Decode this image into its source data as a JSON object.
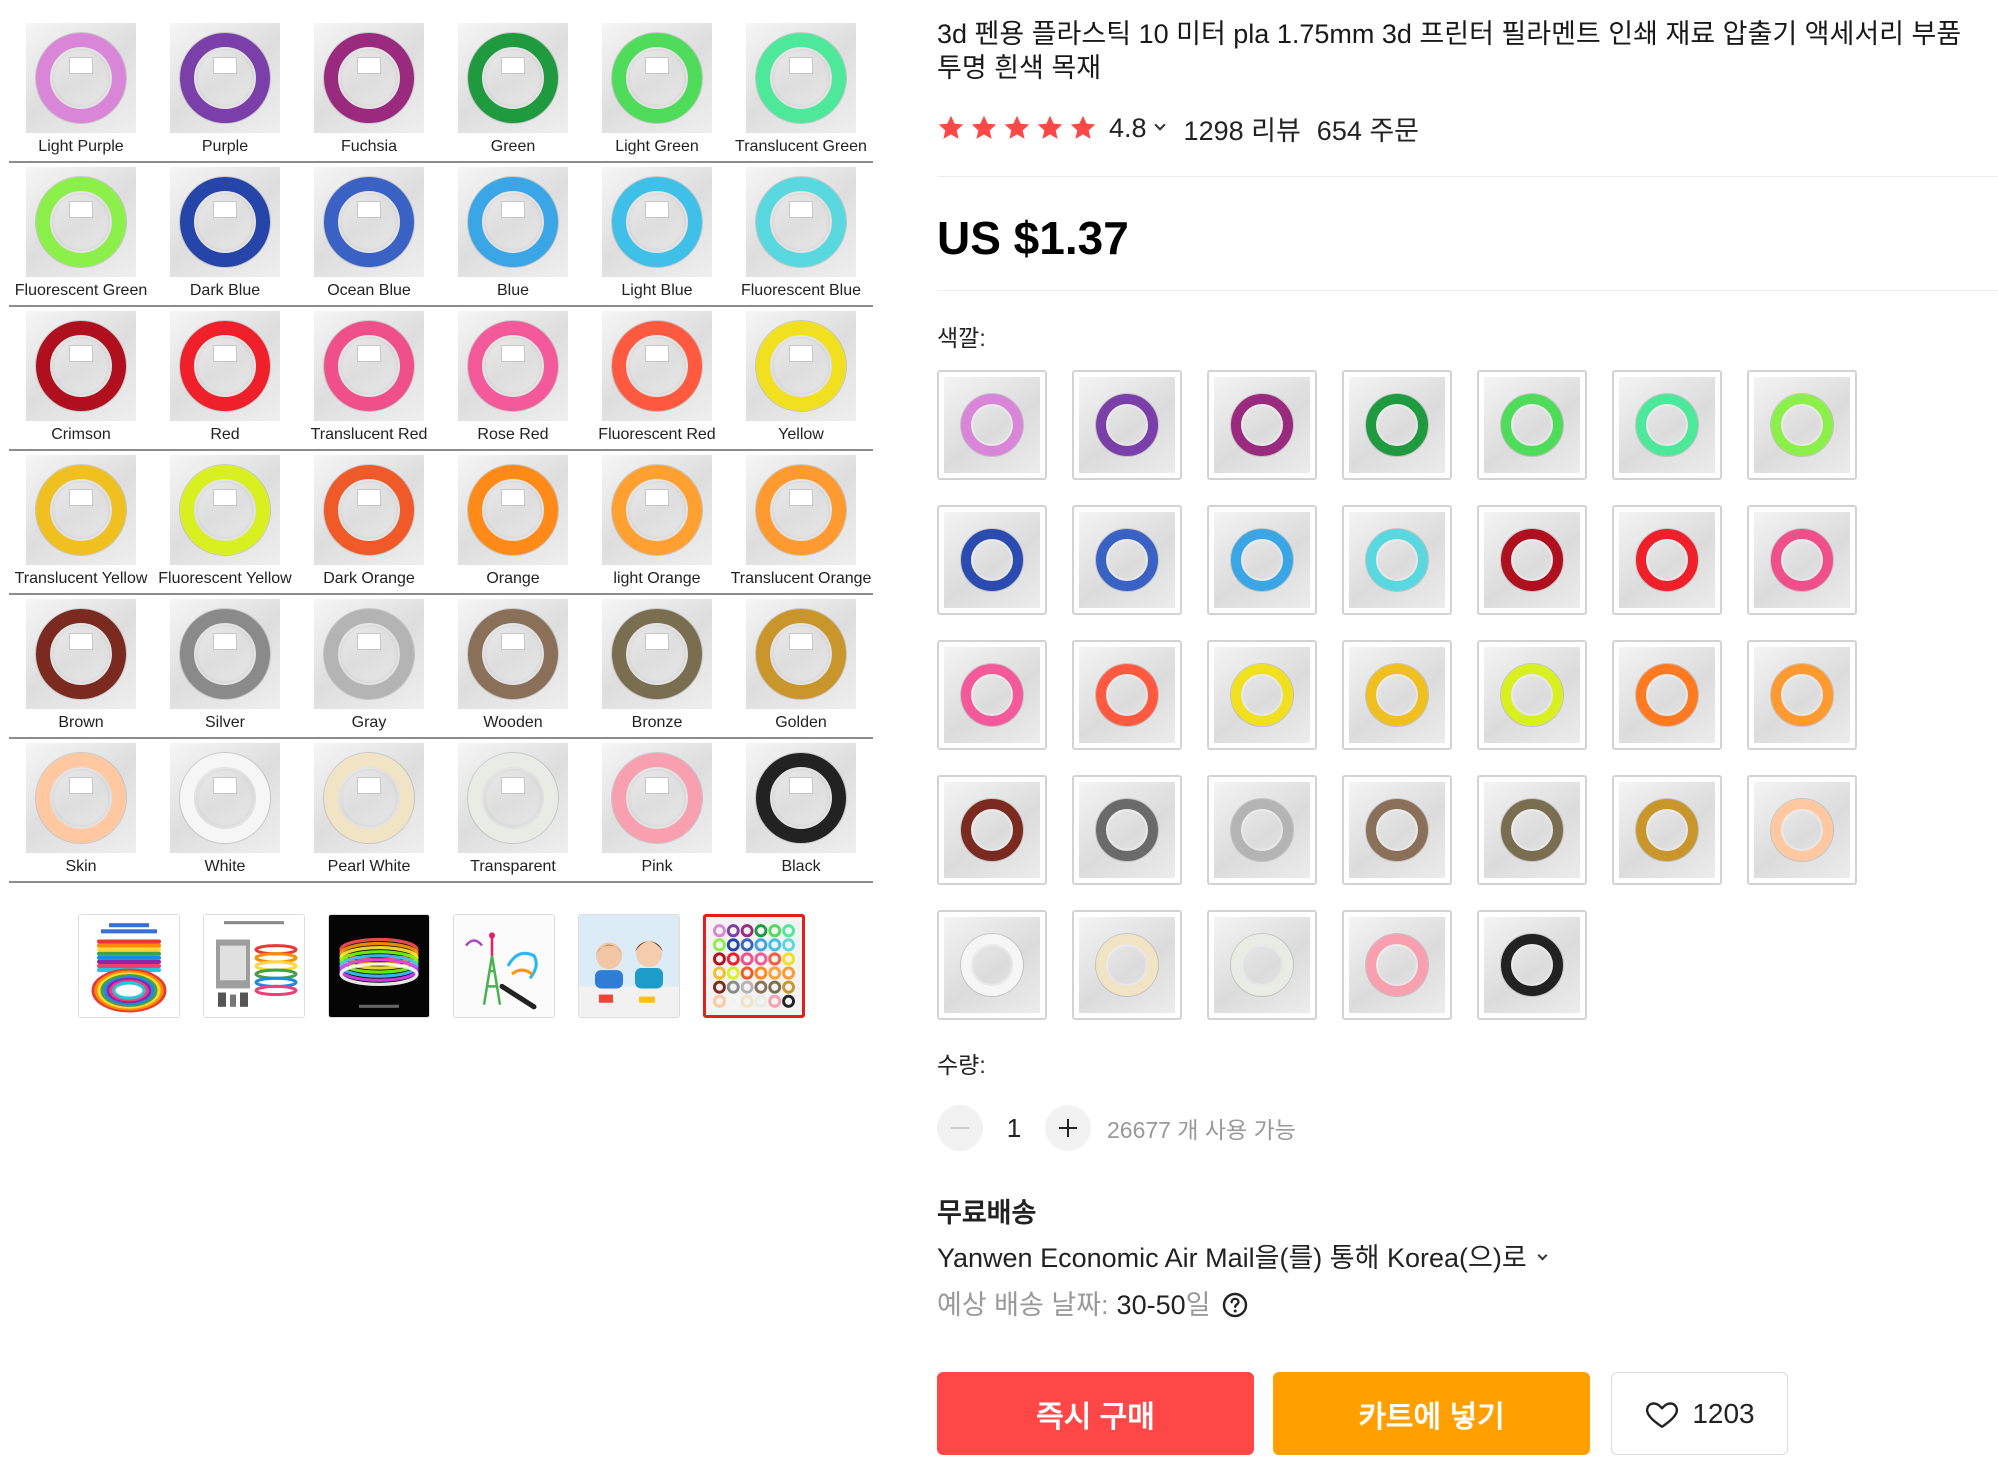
{
  "theme": {
    "accent_red": "#ff4747",
    "accent_orange": "#ffa000",
    "star": "#ff4747",
    "text": "#222222",
    "muted": "#999999",
    "selected_border": "#e0201f"
  },
  "gallery": {
    "cells": [
      {
        "label": "Light Purple",
        "color": "#d985d8"
      },
      {
        "label": "Purple",
        "color": "#7a3fa8"
      },
      {
        "label": "Fuchsia",
        "color": "#9a2a7e"
      },
      {
        "label": "Green",
        "color": "#1f9a3e"
      },
      {
        "label": "Light Green",
        "color": "#4fdc5a"
      },
      {
        "label": "Translucent Green",
        "color": "#4ee89a"
      },
      {
        "label": "Fluorescent Green",
        "color": "#8cf04a"
      },
      {
        "label": "Dark Blue",
        "color": "#2546a8"
      },
      {
        "label": "Ocean Blue",
        "color": "#3a62c4"
      },
      {
        "label": "Blue",
        "color": "#3aa6e6"
      },
      {
        "label": "Light Blue",
        "color": "#3fc0e8"
      },
      {
        "label": "Fluorescent Blue",
        "color": "#5ad8e0"
      },
      {
        "label": "Crimson",
        "color": "#b0101e"
      },
      {
        "label": "Red",
        "color": "#f0202a"
      },
      {
        "label": "Translucent Red",
        "color": "#f0508a"
      },
      {
        "label": "Rose Red",
        "color": "#f45a9a"
      },
      {
        "label": "Fluorescent Red",
        "color": "#ff5a40"
      },
      {
        "label": "Yellow",
        "color": "#f0e020"
      },
      {
        "label": "Translucent Yellow",
        "color": "#f0c020"
      },
      {
        "label": "Fluorescent Yellow",
        "color": "#d8f020"
      },
      {
        "label": "Dark Orange",
        "color": "#f05a28"
      },
      {
        "label": "Orange",
        "color": "#ff8a18"
      },
      {
        "label": "light Orange",
        "color": "#ffa030"
      },
      {
        "label": "Translucent Orange",
        "color": "#ff9a30"
      },
      {
        "label": "Brown",
        "color": "#7a2a1e"
      },
      {
        "label": "Silver",
        "color": "#8a8a8a"
      },
      {
        "label": "Gray",
        "color": "#b4b4b4"
      },
      {
        "label": "Wooden",
        "color": "#8a7058"
      },
      {
        "label": "Bronze",
        "color": "#7a6e50"
      },
      {
        "label": "Golden",
        "color": "#c8962a"
      },
      {
        "label": "Skin",
        "color": "#ffc8a0"
      },
      {
        "label": "White",
        "color": "#f6f6f6"
      },
      {
        "label": "Pearl White",
        "color": "#f0e4c4"
      },
      {
        "label": "Transparent",
        "color": "#e8ece4"
      },
      {
        "label": "Pink",
        "color": "#f8a0b0"
      },
      {
        "label": "Black",
        "color": "#222222"
      }
    ],
    "thumbnails": [
      {
        "image": "rainbow-filament-coils",
        "selected": false
      },
      {
        "image": "3d-printer-with-filament",
        "selected": false
      },
      {
        "image": "glowing-colors-on-black",
        "selected": false
      },
      {
        "image": "3d-pen-drawing",
        "selected": false
      },
      {
        "image": "children-drawing",
        "selected": false
      },
      {
        "image": "color-chart-grid",
        "selected": true
      }
    ]
  },
  "product": {
    "title": "3d 펜용 플라스틱 10 미터 pla 1.75mm 3d 프린터 필라멘트 인쇄 재료 압출기 액세서리 부품 투명 흰색 목재",
    "rating": {
      "score": "4.8",
      "stars_filled": 5,
      "reviews": "1298 리뷰",
      "orders": "654 주문"
    },
    "price": "US $1.37",
    "color": {
      "label": "색깔:",
      "swatches": [
        "#d985d8",
        "#7a3fa8",
        "#9a2a7e",
        "#1f9a3e",
        "#4fdc5a",
        "#4ee89a",
        "#8cf04a",
        "#2a4cb0",
        "#3a62c4",
        "#3aa6e6",
        "#5ad8e0",
        "#b0101e",
        "#f0202a",
        "#f0508a",
        "#f45a9a",
        "#ff5a40",
        "#f0e020",
        "#f0c020",
        "#d8f020",
        "#ff7a20",
        "#ff9a30",
        "#7a2a1e",
        "#6a6a6a",
        "#b4b4b4",
        "#8a7058",
        "#7a6e50",
        "#c8962a",
        "#ffc8a0",
        "#f6f6f6",
        "#f0e4c4",
        "#e8ece4",
        "#f8a0b0",
        "#222222"
      ]
    },
    "quantity": {
      "label": "수량:",
      "value": "1",
      "available": "26677 개 사용 가능"
    },
    "shipping": {
      "title": "무료배송",
      "method": "Yanwen Economic Air Mail을(를) 통해 Korea(으)로",
      "estimate_label": "예상 배송 날짜:",
      "estimate_days": "30-50",
      "estimate_unit": "일"
    },
    "actions": {
      "buy_now": "즉시 구매",
      "add_to_cart": "카트에 넣기",
      "wishlist_count": "1203"
    }
  }
}
